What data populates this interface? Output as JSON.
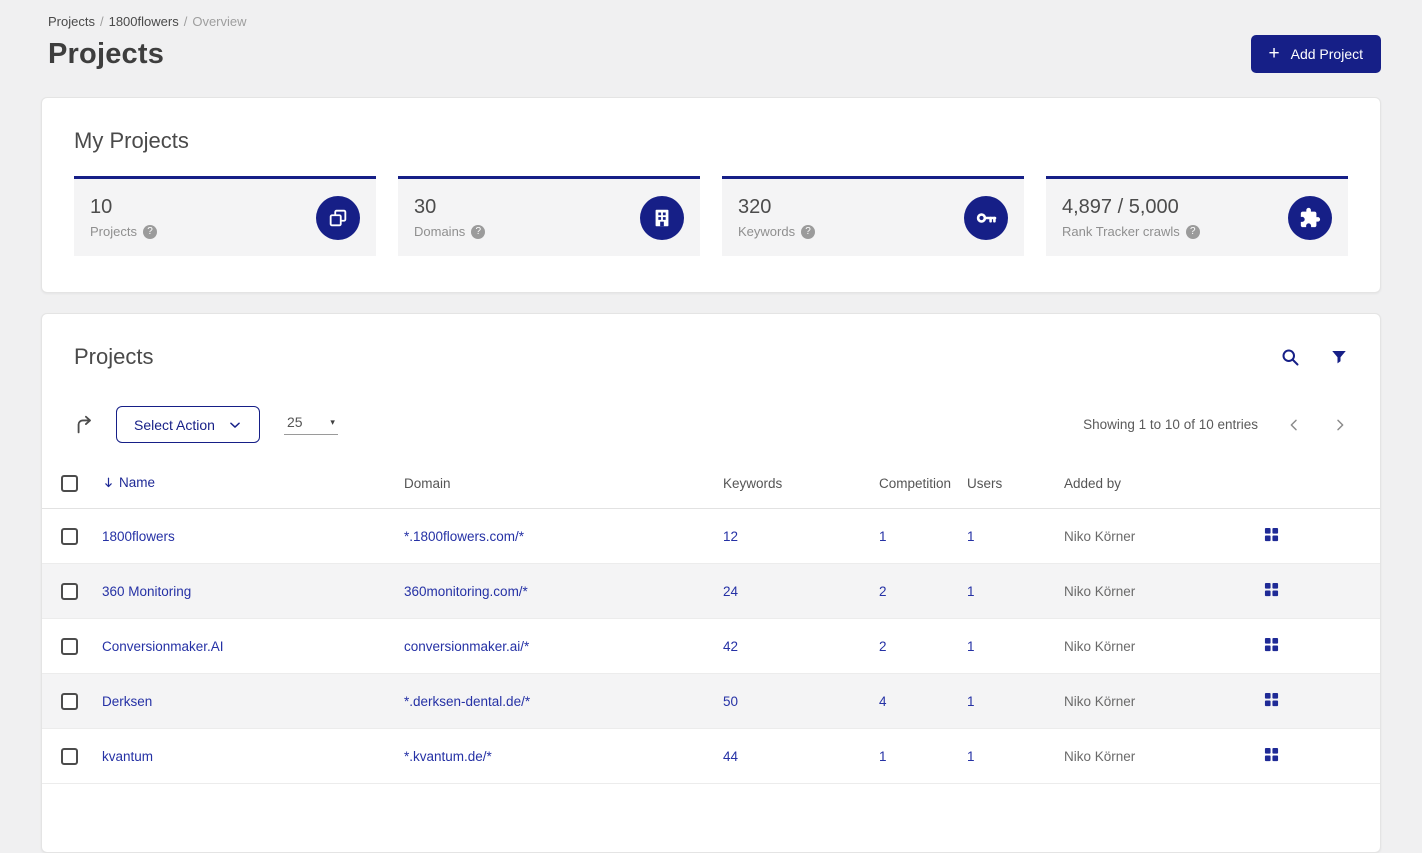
{
  "colors": {
    "accent": "#161f87",
    "link": "#2531a5",
    "page_bg": "#f0f0f1",
    "tile_bg": "#f4f4f5"
  },
  "breadcrumb": {
    "separator": "/",
    "items": [
      "Projects",
      "1800flowers",
      "Overview"
    ]
  },
  "header": {
    "title": "Projects",
    "add_button": "Add Project",
    "plus_glyph": "+"
  },
  "my_projects": {
    "title": "My Projects",
    "help_glyph": "?",
    "stats": [
      {
        "value": "10",
        "label": "Projects",
        "icon": "projects-copy-icon"
      },
      {
        "value": "30",
        "label": "Domains",
        "icon": "building-icon"
      },
      {
        "value": "320",
        "label": "Keywords",
        "icon": "key-icon"
      },
      {
        "value": "4,897 / 5,000",
        "label": "Rank Tracker crawls",
        "icon": "puzzle-icon"
      }
    ]
  },
  "projects": {
    "title": "Projects",
    "toolbar": {
      "select_action": "Select Action",
      "page_size": "25",
      "caret_glyph": "▾",
      "showing": "Showing 1 to 10 of 10 entries"
    },
    "columns": {
      "name": "Name",
      "domain": "Domain",
      "keywords": "Keywords",
      "competition": "Competition",
      "users": "Users",
      "added_by": "Added by"
    },
    "rows": [
      {
        "name": "1800flowers",
        "domain": "*.1800flowers.com/*",
        "keywords": "12",
        "competition": "1",
        "users": "1",
        "added_by": "Niko Körner"
      },
      {
        "name": "360 Monitoring",
        "domain": "360monitoring.com/*",
        "keywords": "24",
        "competition": "2",
        "users": "1",
        "added_by": "Niko Körner"
      },
      {
        "name": "Conversionmaker.AI",
        "domain": "conversionmaker.ai/*",
        "keywords": "42",
        "competition": "2",
        "users": "1",
        "added_by": "Niko Körner"
      },
      {
        "name": "Derksen",
        "domain": "*.derksen-dental.de/*",
        "keywords": "50",
        "competition": "4",
        "users": "1",
        "added_by": "Niko Körner"
      },
      {
        "name": "kvantum",
        "domain": "*.kvantum.de/*",
        "keywords": "44",
        "competition": "1",
        "users": "1",
        "added_by": "Niko Körner"
      }
    ]
  }
}
